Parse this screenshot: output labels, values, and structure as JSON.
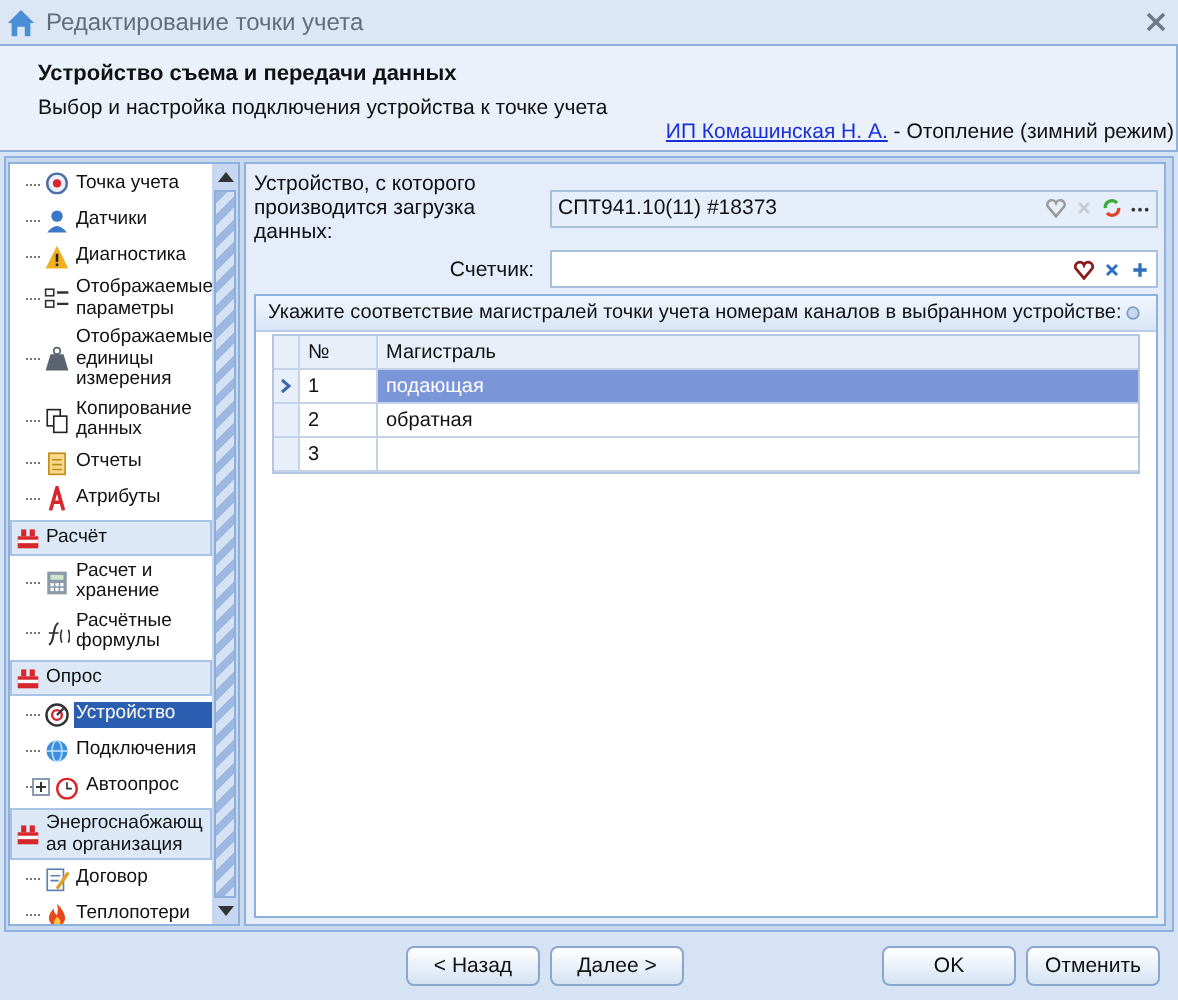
{
  "window": {
    "title": "Редактирование точки учета"
  },
  "header": {
    "title": "Устройство съема и передачи данных",
    "subtitle": "Выбор и настройка подключения устройства к точке учета",
    "link": "ИП  Комашинская Н. А.",
    "context": " - Отопление (зимний режим)"
  },
  "sidebar": {
    "groups": [
      {
        "items": [
          {
            "label": "Точка учета",
            "selected": false
          },
          {
            "label": "Датчики",
            "selected": false
          },
          {
            "label": "Диагностика",
            "selected": false
          },
          {
            "label": "Отображаемые параметры",
            "selected": false
          },
          {
            "label": "Отображаемые единицы измерения",
            "selected": false
          },
          {
            "label": "Копирование данных",
            "selected": false
          },
          {
            "label": "Отчеты",
            "selected": false
          },
          {
            "label": "Атрибуты",
            "selected": false
          }
        ]
      },
      {
        "title": "Расчёт",
        "items": [
          {
            "label": "Расчет и хранение",
            "selected": false
          },
          {
            "label": "Расчётные формулы",
            "selected": false
          }
        ]
      },
      {
        "title": "Опрос",
        "items": [
          {
            "label": "Устройство",
            "selected": true
          },
          {
            "label": "Подключения",
            "selected": false
          },
          {
            "label": "Автоопрос",
            "selected": false,
            "expanded": false
          }
        ]
      },
      {
        "title": "Энергоснабжающая организация",
        "items": [
          {
            "label": "Договор",
            "selected": false
          },
          {
            "label": "Теплопотери",
            "selected": false
          }
        ]
      }
    ]
  },
  "form": {
    "device_label": "Устройство, с которого производится загрузка данных:",
    "device_value": "СПТ941.10(11) #18373",
    "counter_label": "Счетчик:"
  },
  "mapping": {
    "title": "Укажите соответствие магистралей точки учета номерам каналов в выбранном устройстве:",
    "columns": [
      "№",
      "Магистраль"
    ],
    "rows": [
      {
        "number": "1",
        "line": "подающая",
        "selected": true
      },
      {
        "number": "2",
        "line": "обратная",
        "selected": false
      },
      {
        "number": "3",
        "selected": false
      }
    ]
  },
  "buttons": [
    {
      "label": "< Назад"
    },
    {
      "label": "Далее >"
    },
    {
      "label": "OK"
    },
    {
      "label": "Отменить"
    }
  ]
}
